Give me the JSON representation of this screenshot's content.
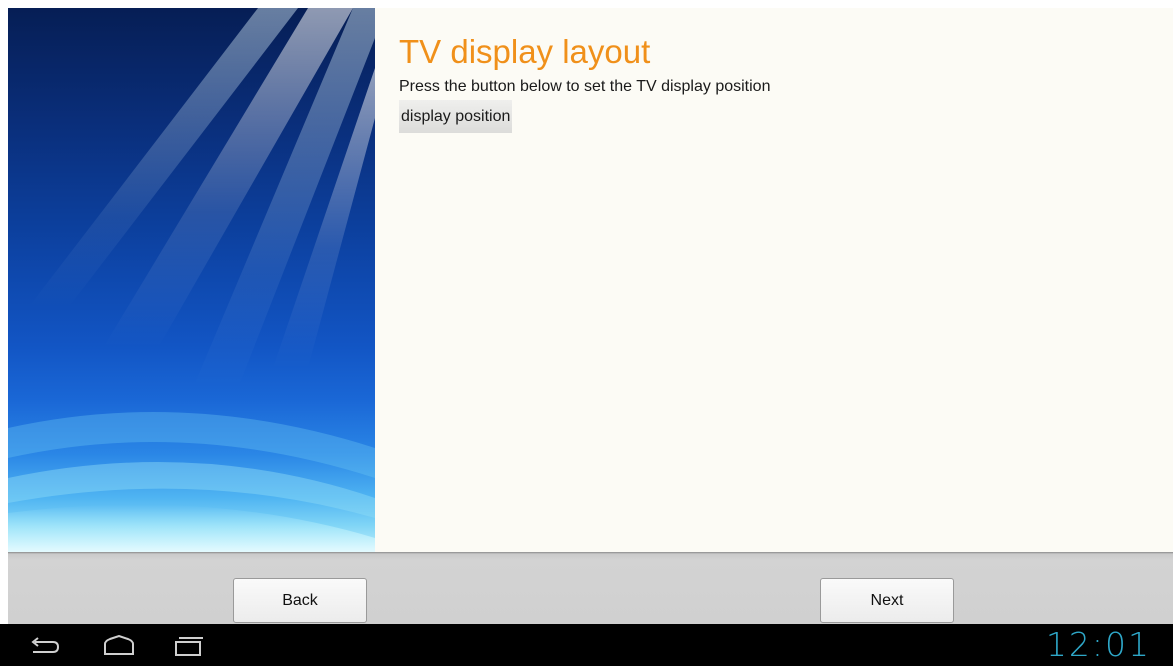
{
  "page": {
    "title": "TV display layout",
    "subtitle": "Press the button below to set the TV display position",
    "display_position_label": "display position"
  },
  "footer": {
    "back_label": "Back",
    "next_label": "Next"
  },
  "system_bar": {
    "clock": "12:01",
    "icons": [
      "back-icon",
      "home-icon",
      "recent-apps-icon"
    ]
  },
  "colors": {
    "title": "#f0901a",
    "clock": "#2ea7c8",
    "content_bg": "#fcfbf5"
  }
}
